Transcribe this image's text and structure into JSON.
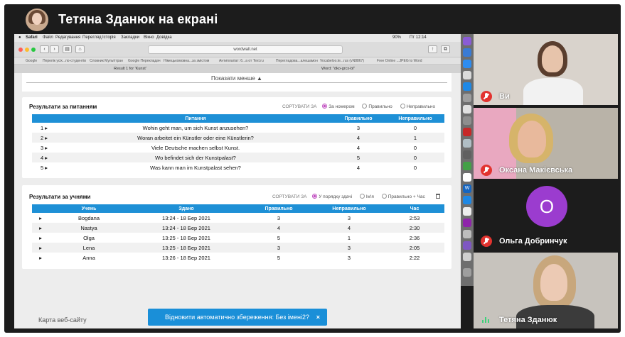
{
  "header": {
    "sharer_title": "Тетяна Зданюк на екрані"
  },
  "mac_menu": {
    "items": [
      "Safari",
      "Файл",
      "Редагування",
      "Перегляд",
      "Історія",
      "Закладки",
      "Вікно",
      "Довідка"
    ],
    "status_time": "Пт 12:14",
    "battery": "90%"
  },
  "browser": {
    "url": "wordwall.net",
    "bookmarks": [
      "Google",
      "Перелік усіх...по-студентів",
      "Словник Мультітран",
      "Google Перекладач",
      "Німецькомовна...за змістом",
      "Антиплагіат: 6...а от Text.ru",
      "Перегладова...алешамон",
      "Vocabeloo.te...rus (vN8867)",
      "Free Online ...JPEG to Word"
    ],
    "tabs": [
      "Result 1 for 'Kunst'",
      "Word: \"dko-grcx-bl\""
    ]
  },
  "page": {
    "show_less": "Показати менше ▲",
    "questions_panel": {
      "title": "Результати за питанням",
      "sort_label": "СОРТУВАТИ ЗА",
      "sort_options": [
        "За номером",
        "Правильно",
        "Неправильно"
      ],
      "columns": [
        "Питання",
        "Правильно",
        "Неправильно"
      ],
      "rows": [
        {
          "num": "1",
          "question": "Wohin geht man, um sich Kunst anzusehen?",
          "correct": "3",
          "incorrect": "0"
        },
        {
          "num": "2",
          "question": "Woran arbeitet ein Künstler oder eine Künstlerin?",
          "correct": "4",
          "incorrect": "1"
        },
        {
          "num": "3",
          "question": "Viele Deutsche machen selbst Kunst.",
          "correct": "4",
          "incorrect": "0"
        },
        {
          "num": "4",
          "question": "Wo befindet sich der Kunstpalast?",
          "correct": "5",
          "incorrect": "0"
        },
        {
          "num": "5",
          "question": "Was kann man im Kunstpalast sehen?",
          "correct": "4",
          "incorrect": "0"
        }
      ]
    },
    "students_panel": {
      "title": "Результати за учнями",
      "sort_label": "СОРТУВАТИ ЗА",
      "sort_options": [
        "У порядку здачі",
        "Ім'я",
        "Правильно + Час"
      ],
      "columns": [
        "Учень",
        "Здано",
        "Правильно",
        "Неправильно",
        "Час"
      ],
      "rows": [
        {
          "name": "Bogdana",
          "submitted": "13:24 - 18 Бер 2021",
          "correct": "3",
          "incorrect": "3",
          "time": "2:53"
        },
        {
          "name": "Nastya",
          "submitted": "13:24 - 18 Бер 2021",
          "correct": "4",
          "incorrect": "4",
          "time": "2:30"
        },
        {
          "name": "Olga",
          "submitted": "13:25 - 18 Бер 2021",
          "correct": "5",
          "incorrect": "1",
          "time": "2:36"
        },
        {
          "name": "Lena",
          "submitted": "13:25 - 18 Бер 2021",
          "correct": "3",
          "incorrect": "3",
          "time": "2:05"
        },
        {
          "name": "Anna",
          "submitted": "13:26 - 18 Бер 2021",
          "correct": "5",
          "incorrect": "3",
          "time": "2:22"
        }
      ]
    },
    "footer_link": "Карта веб-сайту",
    "toast": {
      "text": "Відновити автоматично збереження: Без імені2?",
      "close": "×"
    }
  },
  "participants": [
    {
      "name": "Ви",
      "muted": true
    },
    {
      "name": "Оксана Макієвська",
      "muted": true
    },
    {
      "name": "Ольга Добринчук",
      "muted": true,
      "initial": "O"
    },
    {
      "name": "Тетяна Зданюк",
      "muted": false
    }
  ],
  "colors": {
    "table_header": "#1e90d6",
    "toast": "#1a8fd8",
    "mute": "#e2332f",
    "avatar_purple": "#9b3ccf",
    "radio_on": "#c04ec0"
  }
}
